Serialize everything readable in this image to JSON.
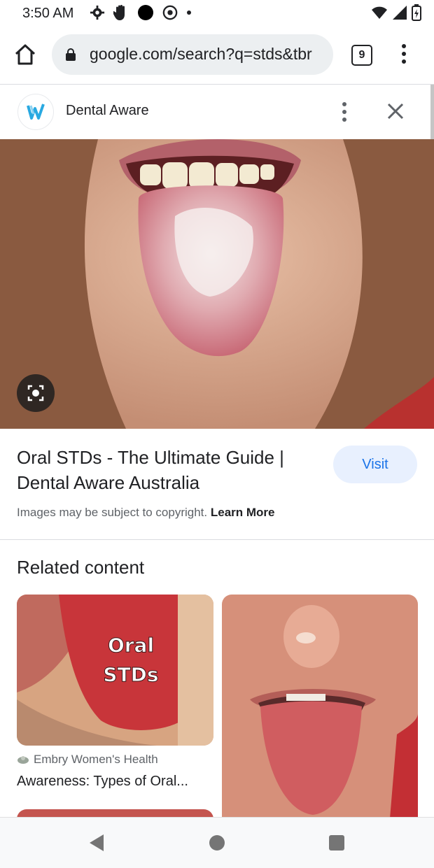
{
  "status_bar": {
    "time": "3:50 AM"
  },
  "browser": {
    "url": "google.com/search?q=stds&tbr",
    "tab_count": "9"
  },
  "panel": {
    "site_name": "Dental Aware"
  },
  "result": {
    "title": "Oral STDs - The Ultimate Guide | Dental Aware Australia",
    "visit_label": "Visit",
    "copyright_text": "Images may be subject to copyright.",
    "learn_more": "Learn More"
  },
  "related": {
    "heading": "Related content",
    "cards": [
      {
        "overlay_text_1": "Oral",
        "overlay_text_2": "STDs",
        "source": "Embry Women's Health",
        "description": "Awareness: Types of Oral..."
      }
    ]
  },
  "colors": {
    "accent": "#1a73e8",
    "visit_bg": "#e8f0fe",
    "omnibox_bg": "#eceff1"
  },
  "icons": [
    "settings-icon",
    "hand-icon",
    "circle-icon",
    "chrome-icon",
    "wifi-icon",
    "signal-icon",
    "battery-icon",
    "home-icon",
    "lock-icon",
    "tabs-icon",
    "more-vert-icon",
    "close-icon",
    "lens-icon",
    "back-icon",
    "home-nav-icon",
    "recents-icon"
  ]
}
